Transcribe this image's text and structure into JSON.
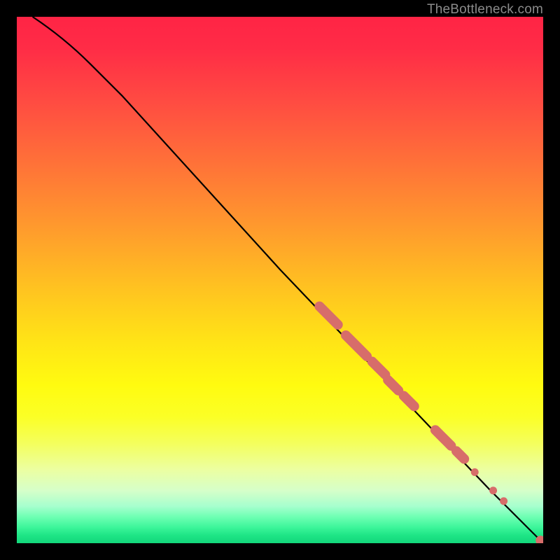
{
  "attribution": "TheBottleneck.com",
  "chart_data": {
    "type": "line",
    "title": "",
    "xlabel": "",
    "ylabel": "",
    "xlim": [
      0,
      100
    ],
    "ylim": [
      0,
      100
    ],
    "curve": [
      {
        "x": 3,
        "y": 100
      },
      {
        "x": 7,
        "y": 97
      },
      {
        "x": 12,
        "y": 93
      },
      {
        "x": 20,
        "y": 85
      },
      {
        "x": 30,
        "y": 74
      },
      {
        "x": 40,
        "y": 63
      },
      {
        "x": 50,
        "y": 52
      },
      {
        "x": 60,
        "y": 41.5
      },
      {
        "x": 70,
        "y": 31
      },
      {
        "x": 80,
        "y": 20.5
      },
      {
        "x": 90,
        "y": 10
      },
      {
        "x": 100,
        "y": 0
      }
    ],
    "point_r1": 7,
    "point_r2": 5.5,
    "point_color": "#d76d6a",
    "segments": [
      {
        "x0": 57.5,
        "y0": 45.0,
        "x1": 61.0,
        "y1": 41.5
      },
      {
        "x0": 62.5,
        "y0": 39.5,
        "x1": 66.5,
        "y1": 35.5
      },
      {
        "x0": 67.5,
        "y0": 34.5,
        "x1": 70.0,
        "y1": 32.0
      },
      {
        "x0": 70.5,
        "y0": 31.0,
        "x1": 72.5,
        "y1": 29.0
      },
      {
        "x0": 73.5,
        "y0": 28.0,
        "x1": 75.5,
        "y1": 26.0
      },
      {
        "x0": 79.5,
        "y0": 21.5,
        "x1": 82.5,
        "y1": 18.5
      },
      {
        "x0": 83.5,
        "y0": 17.5,
        "x1": 85.0,
        "y1": 16.0
      }
    ],
    "dots": [
      {
        "x": 87.0,
        "y": 13.5
      },
      {
        "x": 90.5,
        "y": 10.0
      },
      {
        "x": 92.5,
        "y": 8.0
      },
      {
        "x": 99.5,
        "y": 0.5
      }
    ]
  }
}
